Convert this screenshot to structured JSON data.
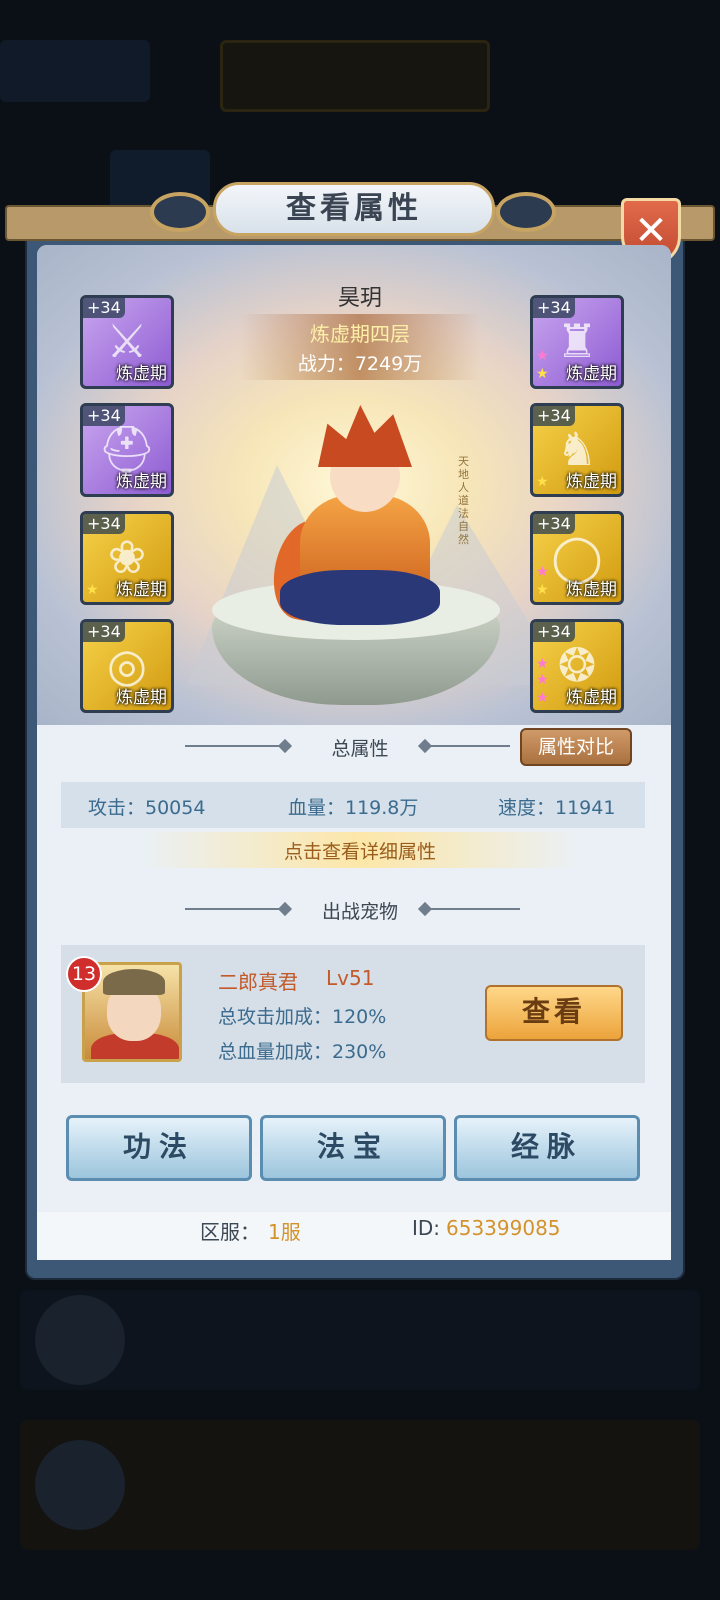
{
  "panel": {
    "title": "查看属性",
    "close_glyph": "✕"
  },
  "hero": {
    "name": "昊玥",
    "realm": "炼虚期四层",
    "power": "战力：7249万",
    "calligraphy": "天地人道法自然"
  },
  "equipment": {
    "left": [
      {
        "level": "+34",
        "stage": "炼虚期",
        "icon": "sword-icon",
        "rarity": "purple",
        "stars": 0
      },
      {
        "level": "+34",
        "stage": "炼虚期",
        "icon": "helmet-icon",
        "rarity": "purple",
        "stars": 0
      },
      {
        "level": "+34",
        "stage": "炼虚期",
        "icon": "amulet-icon",
        "rarity": "gold",
        "stars": 1
      },
      {
        "level": "+34",
        "stage": "炼虚期",
        "icon": "ring-icon",
        "rarity": "gold",
        "stars": 0
      }
    ],
    "right": [
      {
        "level": "+34",
        "stage": "炼虚期",
        "icon": "armor-icon",
        "rarity": "purple",
        "stars": 2
      },
      {
        "level": "+34",
        "stage": "炼虚期",
        "icon": "boots-icon",
        "rarity": "gold",
        "stars": 1
      },
      {
        "level": "+34",
        "stage": "炼虚期",
        "icon": "belt-icon",
        "rarity": "gold",
        "stars": 2
      },
      {
        "level": "+34",
        "stage": "炼虚期",
        "icon": "jade-pendant-icon",
        "rarity": "gold",
        "stars": 3
      }
    ]
  },
  "stats": {
    "section_title": "总属性",
    "compare_label": "属性对比",
    "attack": "攻击：50054",
    "hp": "血量：119.8万",
    "speed": "速度：11941",
    "detail_link": "点击查看详细属性"
  },
  "pet": {
    "section_title": "出战宠物",
    "badge": "13",
    "name": "二郎真君",
    "level": "Lv51",
    "attack_bonus": "总攻击加成：120%",
    "hp_bonus": "总血量加成：230%",
    "view_label": "查看"
  },
  "tabs": [
    "功法",
    "法宝",
    "经脉"
  ],
  "footer": {
    "server_label": "区服：",
    "server_value": "1服",
    "id_label": "ID:",
    "id_value": "653399085"
  },
  "colors": {
    "accent_gold": "#c8a463",
    "stat_blue": "#3b6b8e",
    "pet_name_red": "#c25a2a",
    "footer_value_orange": "#d4922a"
  }
}
